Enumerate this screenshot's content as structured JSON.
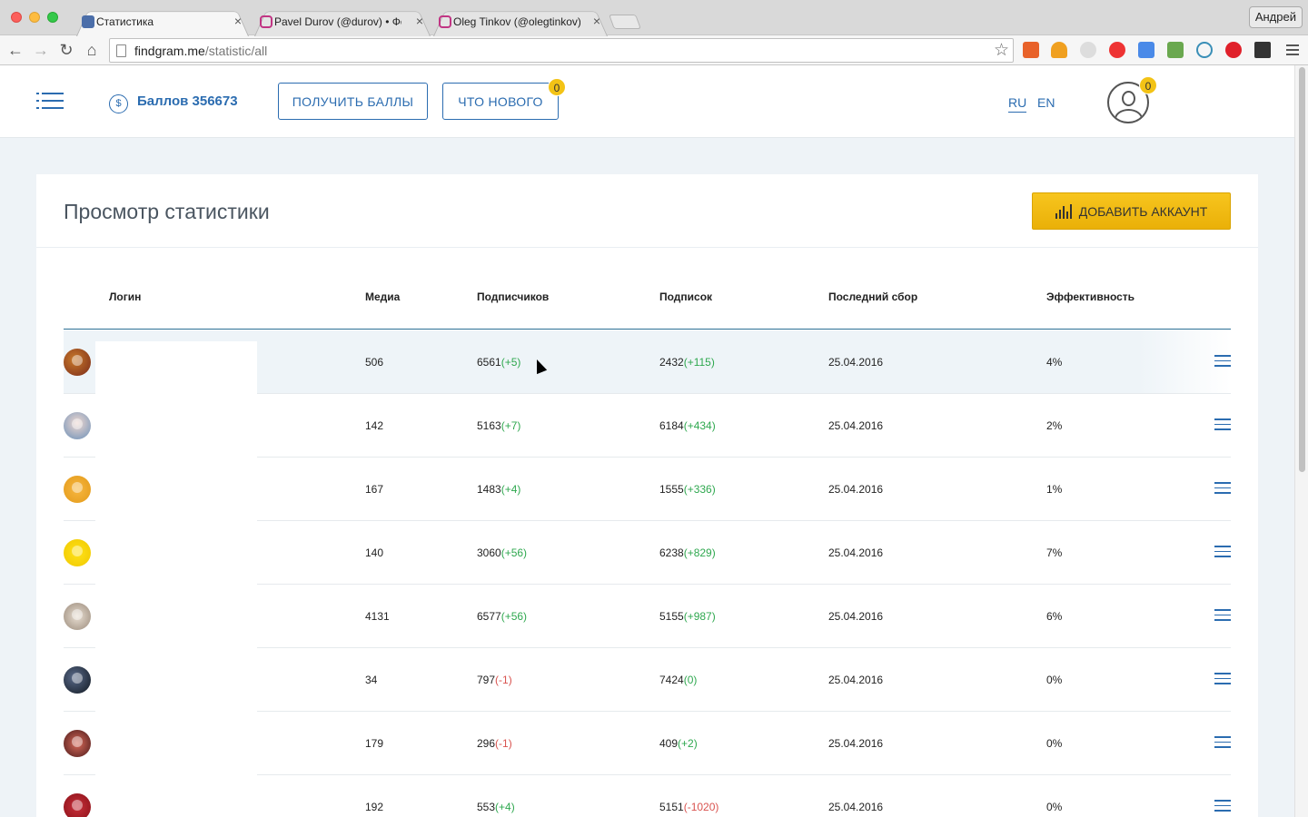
{
  "browser": {
    "tabs": [
      {
        "title": "Статистика",
        "icon": "findgram-favicon",
        "active": true
      },
      {
        "title": "Pavel Durov (@durov) • Фо",
        "icon": "instagram-favicon",
        "active": false
      },
      {
        "title": "Oleg Tinkov (@olegtinkov)",
        "icon": "instagram-favicon",
        "active": false
      }
    ],
    "profile": "Андрей",
    "url_domain": "findgram.me",
    "url_path": "/statistic/all"
  },
  "header": {
    "balance": "Баллов 356673",
    "earn_button": "ПОЛУЧИТЬ БАЛЛЫ",
    "news_button": "ЧТО НОВОГО",
    "news_badge": "0",
    "lang_ru": "RU",
    "lang_en": "EN",
    "user_badge": "0"
  },
  "page": {
    "title": "Просмотр статистики",
    "add_button": "ДОБАВИТЬ АККАУНТ"
  },
  "table": {
    "columns": [
      "Логин",
      "Медиа",
      "Подписчиков",
      "Подписок",
      "Последний сбор",
      "Эффективность"
    ],
    "rows": [
      {
        "media": "506",
        "followers": "6561",
        "followers_delta": "(+5)",
        "following": "2432",
        "following_delta": "(+115)",
        "date": "25.04.2016",
        "eff": "4%"
      },
      {
        "media": "142",
        "followers": "5163",
        "followers_delta": "(+7)",
        "following": "6184",
        "following_delta": "(+434)",
        "date": "25.04.2016",
        "eff": "2%"
      },
      {
        "media": "167",
        "followers": "1483",
        "followers_delta": "(+4)",
        "following": "1555",
        "following_delta": "(+336)",
        "date": "25.04.2016",
        "eff": "1%"
      },
      {
        "media": "140",
        "followers": "3060",
        "followers_delta": "(+56)",
        "following": "6238",
        "following_delta": "(+829)",
        "date": "25.04.2016",
        "eff": "7%"
      },
      {
        "media": "4131",
        "followers": "6577",
        "followers_delta": "(+56)",
        "following": "5155",
        "following_delta": "(+987)",
        "date": "25.04.2016",
        "eff": "6%"
      },
      {
        "media": "34",
        "followers": "797",
        "followers_delta": "(-1)",
        "following": "7424",
        "following_delta": "(0)",
        "date": "25.04.2016",
        "eff": "0%"
      },
      {
        "media": "179",
        "followers": "296",
        "followers_delta": "(-1)",
        "following": "409",
        "following_delta": "(+2)",
        "date": "25.04.2016",
        "eff": "0%"
      },
      {
        "media": "192",
        "followers": "553",
        "followers_delta": "(+4)",
        "following": "5151",
        "following_delta": "(-1020)",
        "date": "25.04.2016",
        "eff": "0%"
      }
    ]
  },
  "colors": {
    "accent": "#2b6cb0",
    "yellow": "#f3c316",
    "positive": "#2fa84f",
    "negative": "#d9534f"
  }
}
